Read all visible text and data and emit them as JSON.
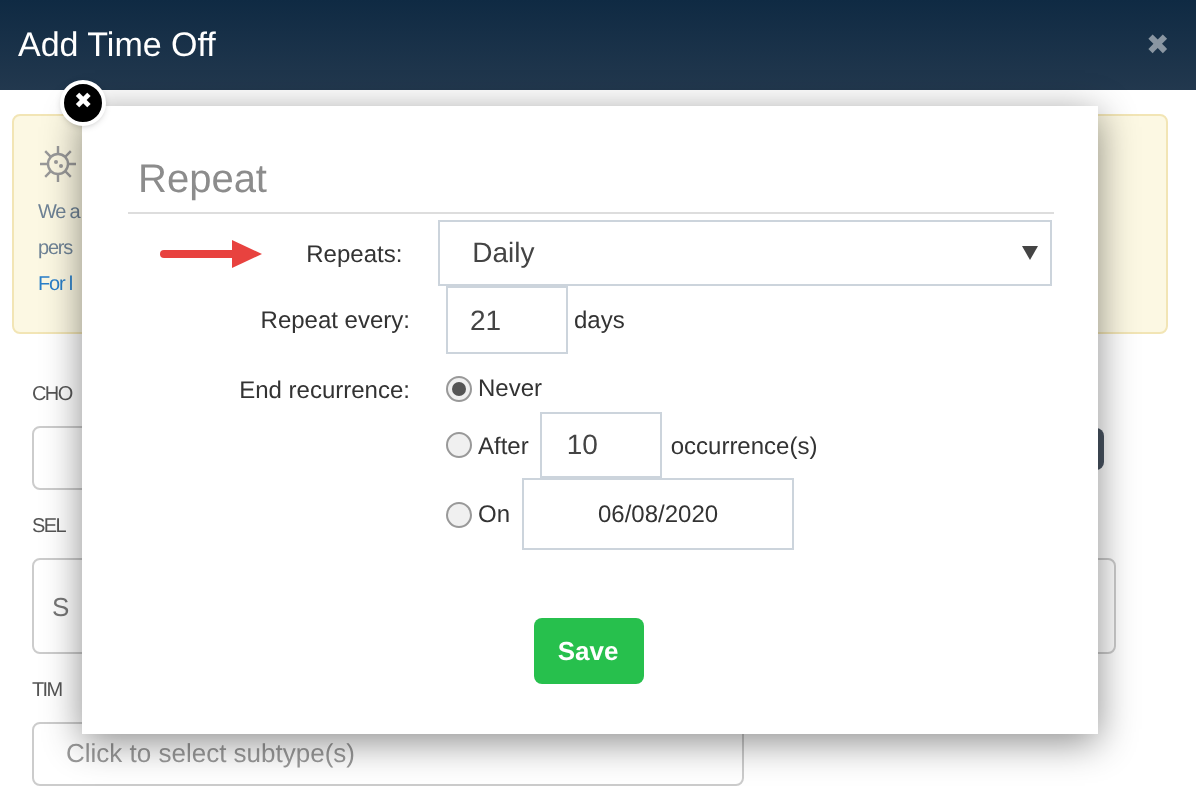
{
  "window": {
    "title": "Add Time Off",
    "close": "✖"
  },
  "notice": {
    "lines": [
      {
        "text": "We a",
        "kind": "text"
      },
      {
        "text": "pers",
        "kind": "text"
      },
      {
        "text": "For l",
        "kind": "link"
      }
    ]
  },
  "form": {
    "fields": [
      {
        "label": "CHO",
        "kind": "input"
      },
      {
        "label": "SEL",
        "kind": "textarea",
        "value": "S"
      },
      {
        "label": "TIM",
        "kind": "input",
        "placeholder": "Click to select subtype(s)"
      }
    ]
  },
  "dialog": {
    "title": "Repeat",
    "close": "✖",
    "repeats": {
      "label": "Repeats:",
      "value": "Daily"
    },
    "repeat_every": {
      "label": "Repeat every:",
      "value": "21",
      "unit": "days"
    },
    "end_recurrence": {
      "label": "End recurrence:",
      "options": [
        {
          "label": "Never",
          "selected": true
        },
        {
          "label": "After",
          "selected": false,
          "value": "10",
          "unit": "occurrence(s)"
        },
        {
          "label": "On",
          "selected": false,
          "value": "06/08/2020"
        }
      ]
    },
    "save": "Save"
  }
}
